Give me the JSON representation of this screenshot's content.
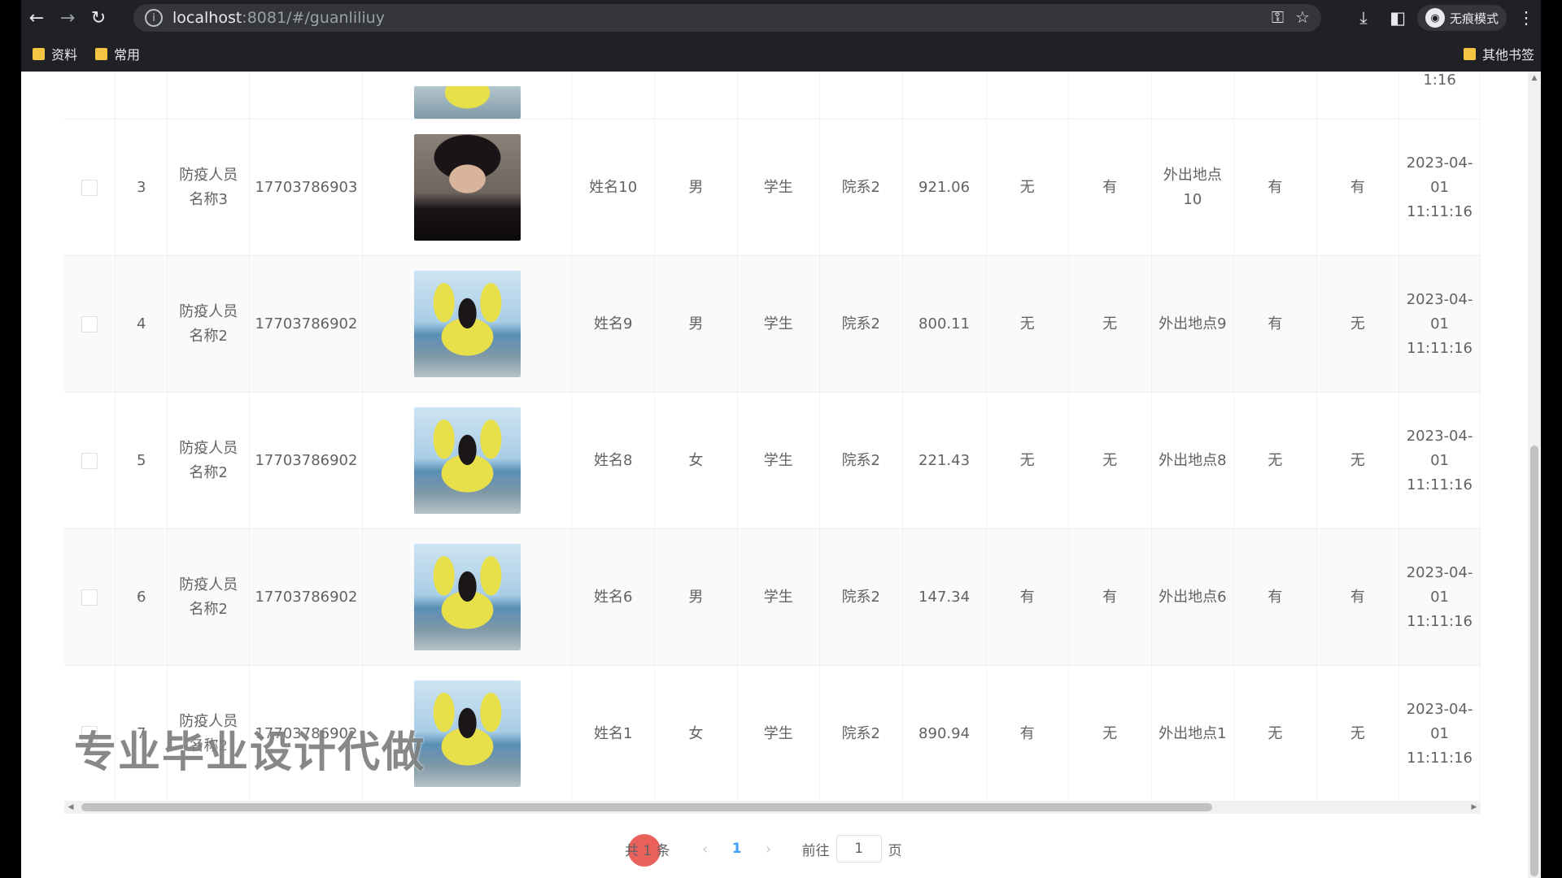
{
  "browser": {
    "url_host": "localhost",
    "url_path": ":8081/#/guanliliuy",
    "incognito_label": "无痕模式",
    "bookmarks": [
      "资料",
      "常用"
    ],
    "other_bookmarks": "其他书签"
  },
  "table": {
    "partial_row": {
      "time_tail": "1:16"
    },
    "rows": [
      {
        "index": "3",
        "person": "防疫人员名称3",
        "phone": "17703786903",
        "photo": "man",
        "name": "姓名10",
        "gender": "男",
        "role": "学生",
        "dept": "院系2",
        "value": "921.06",
        "c1": "无",
        "c2": "有",
        "place": "外出地点10",
        "c3": "有",
        "c4": "有",
        "time": "2023-04-01 11:11:16"
      },
      {
        "index": "4",
        "person": "防疫人员名称2",
        "phone": "17703786902",
        "photo": "girl",
        "name": "姓名9",
        "gender": "男",
        "role": "学生",
        "dept": "院系2",
        "value": "800.11",
        "c1": "无",
        "c2": "无",
        "place": "外出地点9",
        "c3": "有",
        "c4": "无",
        "time": "2023-04-01 11:11:16"
      },
      {
        "index": "5",
        "person": "防疫人员名称2",
        "phone": "17703786902",
        "photo": "girl",
        "name": "姓名8",
        "gender": "女",
        "role": "学生",
        "dept": "院系2",
        "value": "221.43",
        "c1": "无",
        "c2": "无",
        "place": "外出地点8",
        "c3": "无",
        "c4": "无",
        "time": "2023-04-01 11:11:16"
      },
      {
        "index": "6",
        "person": "防疫人员名称2",
        "phone": "17703786902",
        "photo": "girl",
        "name": "姓名6",
        "gender": "男",
        "role": "学生",
        "dept": "院系2",
        "value": "147.34",
        "c1": "有",
        "c2": "有",
        "place": "外出地点6",
        "c3": "有",
        "c4": "有",
        "time": "2023-04-01 11:11:16"
      },
      {
        "index": "7",
        "person": "防疫人员名称2",
        "phone": "17703786902",
        "photo": "girl",
        "name": "姓名1",
        "gender": "女",
        "role": "学生",
        "dept": "院系2",
        "value": "890.94",
        "c1": "有",
        "c2": "无",
        "place": "外出地点1",
        "c3": "无",
        "c4": "无",
        "time": "2023-04-01 11:11:16"
      }
    ]
  },
  "pagination": {
    "total_label": "共 1 条",
    "prev": "‹",
    "current_page": "1",
    "next": "›",
    "goto_prefix": "前往",
    "goto_value": "1",
    "goto_suffix": "页"
  },
  "watermark": "专业毕业设计代做"
}
